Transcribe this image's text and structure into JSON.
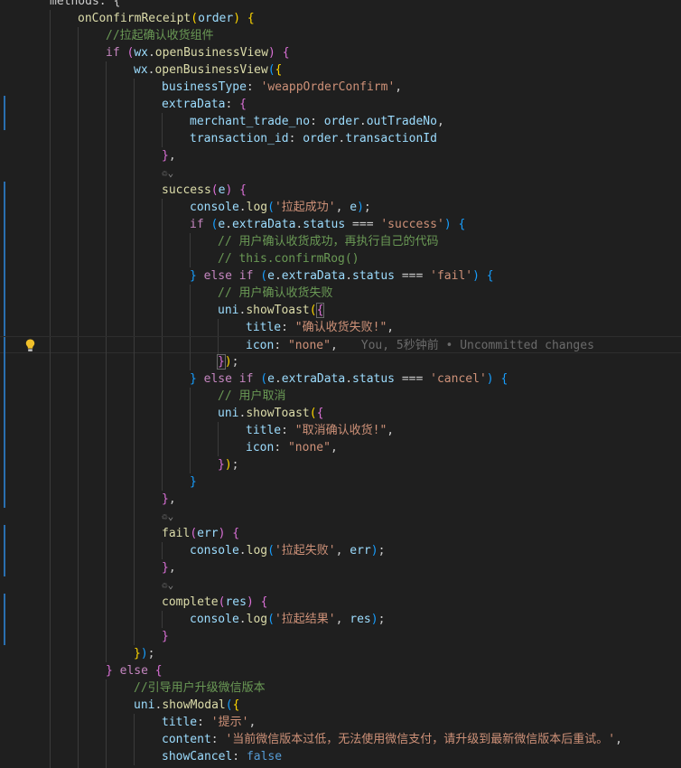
{
  "editor": {
    "lightbulb_icon": "lightbulb-icon",
    "fold_icon_name": "codelens-fold-icon",
    "colors": {
      "background": "#1f1f1f",
      "keyword": "#c586c0",
      "function": "#dcdcaa",
      "property": "#9cdcfe",
      "string": "#ce9178",
      "comment": "#6a9955",
      "bracket_1": "#ffd700",
      "bracket_2": "#da70d6",
      "bracket_3": "#179fff",
      "boolean": "#569cd6",
      "gutter_modified": "#2a6fb0"
    },
    "lines": [
      {
        "t": [
          [
            "w",
            "methods: {"
          ]
        ]
      },
      {
        "t": [
          [
            "f",
            "onConfirmReceipt"
          ],
          [
            "b1",
            "("
          ],
          [
            "p",
            "order"
          ],
          [
            "b1",
            ")"
          ],
          [
            "w",
            " "
          ],
          [
            "b1",
            "{"
          ]
        ]
      },
      {
        "t": [
          [
            "c",
            "//拉起确认收货组件"
          ]
        ]
      },
      {
        "t": [
          [
            "k",
            "if"
          ],
          [
            "w",
            " "
          ],
          [
            "b2",
            "("
          ],
          [
            "p",
            "wx"
          ],
          [
            "w",
            "."
          ],
          [
            "f",
            "openBusinessView"
          ],
          [
            "b2",
            ")"
          ],
          [
            "w",
            " "
          ],
          [
            "b2",
            "{"
          ]
        ]
      },
      {
        "t": [
          [
            "p",
            "wx"
          ],
          [
            "w",
            "."
          ],
          [
            "f",
            "openBusinessView"
          ],
          [
            "b3",
            "("
          ],
          [
            "b1",
            "{"
          ]
        ]
      },
      {
        "t": [
          [
            "p",
            "businessType"
          ],
          [
            "w",
            ": "
          ],
          [
            "s",
            "'weappOrderConfirm'"
          ],
          [
            "w",
            ","
          ]
        ]
      },
      {
        "t": [
          [
            "p",
            "extraData"
          ],
          [
            "w",
            ": "
          ],
          [
            "b2",
            "{"
          ]
        ]
      },
      {
        "t": [
          [
            "p",
            "merchant_trade_no"
          ],
          [
            "w",
            ": "
          ],
          [
            "p",
            "order"
          ],
          [
            "w",
            "."
          ],
          [
            "p",
            "outTradeNo"
          ],
          [
            "w",
            ","
          ]
        ]
      },
      {
        "t": [
          [
            "p",
            "transaction_id"
          ],
          [
            "w",
            ": "
          ],
          [
            "p",
            "order"
          ],
          [
            "w",
            "."
          ],
          [
            "p",
            "transactionId"
          ]
        ]
      },
      {
        "t": [
          [
            "b2",
            "}"
          ],
          [
            "w",
            ","
          ]
        ]
      },
      {
        "t": []
      },
      {
        "t": [
          [
            "f",
            "success"
          ],
          [
            "b2",
            "("
          ],
          [
            "p",
            "e"
          ],
          [
            "b2",
            ")"
          ],
          [
            "w",
            " "
          ],
          [
            "b2",
            "{"
          ]
        ]
      },
      {
        "t": [
          [
            "p",
            "console"
          ],
          [
            "w",
            "."
          ],
          [
            "f",
            "log"
          ],
          [
            "b3",
            "("
          ],
          [
            "s",
            "'拉起成功'"
          ],
          [
            "w",
            ", "
          ],
          [
            "p",
            "e"
          ],
          [
            "b3",
            ")"
          ],
          [
            "w",
            ";"
          ]
        ]
      },
      {
        "t": [
          [
            "k",
            "if"
          ],
          [
            "w",
            " "
          ],
          [
            "b3",
            "("
          ],
          [
            "p",
            "e"
          ],
          [
            "w",
            "."
          ],
          [
            "p",
            "extraData"
          ],
          [
            "w",
            "."
          ],
          [
            "p",
            "status"
          ],
          [
            "w",
            " === "
          ],
          [
            "s",
            "'success'"
          ],
          [
            "b3",
            ")"
          ],
          [
            "w",
            " "
          ],
          [
            "b3",
            "{"
          ]
        ]
      },
      {
        "t": [
          [
            "c",
            "// 用户确认收货成功，再执行自己的代码"
          ]
        ]
      },
      {
        "t": [
          [
            "c",
            "// this.confirmRog()"
          ]
        ]
      },
      {
        "t": [
          [
            "b3",
            "}"
          ],
          [
            "w",
            " "
          ],
          [
            "k",
            "else"
          ],
          [
            "w",
            " "
          ],
          [
            "k",
            "if"
          ],
          [
            "w",
            " "
          ],
          [
            "b3",
            "("
          ],
          [
            "p",
            "e"
          ],
          [
            "w",
            "."
          ],
          [
            "p",
            "extraData"
          ],
          [
            "w",
            "."
          ],
          [
            "p",
            "status"
          ],
          [
            "w",
            " === "
          ],
          [
            "s",
            "'fail'"
          ],
          [
            "b3",
            ")"
          ],
          [
            "w",
            " "
          ],
          [
            "b3",
            "{"
          ]
        ]
      },
      {
        "t": [
          [
            "c",
            "// 用户确认收货失败"
          ]
        ]
      },
      {
        "t": [
          [
            "p",
            "uni"
          ],
          [
            "w",
            "."
          ],
          [
            "f",
            "showToast"
          ],
          [
            "b1",
            "("
          ],
          [
            "b2",
            "{"
          ]
        ]
      },
      {
        "t": [
          [
            "p",
            "title"
          ],
          [
            "w",
            ": "
          ],
          [
            "s",
            "\"确认收货失败!\""
          ],
          [
            "w",
            ","
          ]
        ]
      },
      {
        "t": [
          [
            "p",
            "icon"
          ],
          [
            "w",
            ": "
          ],
          [
            "s",
            "\"none\""
          ],
          [
            "w",
            ","
          ]
        ],
        "blame": "You, 5秒钟前 • Uncommitted changes"
      },
      {
        "t": [
          [
            "b2",
            "}"
          ],
          [
            "b1",
            ")"
          ],
          [
            "w",
            ";"
          ]
        ]
      },
      {
        "t": [
          [
            "b3",
            "}"
          ],
          [
            "w",
            " "
          ],
          [
            "k",
            "else"
          ],
          [
            "w",
            " "
          ],
          [
            "k",
            "if"
          ],
          [
            "w",
            " "
          ],
          [
            "b3",
            "("
          ],
          [
            "p",
            "e"
          ],
          [
            "w",
            "."
          ],
          [
            "p",
            "extraData"
          ],
          [
            "w",
            "."
          ],
          [
            "p",
            "status"
          ],
          [
            "w",
            " === "
          ],
          [
            "s",
            "'cancel'"
          ],
          [
            "b3",
            ")"
          ],
          [
            "w",
            " "
          ],
          [
            "b3",
            "{"
          ]
        ]
      },
      {
        "t": [
          [
            "c",
            "// 用户取消"
          ]
        ]
      },
      {
        "t": [
          [
            "p",
            "uni"
          ],
          [
            "w",
            "."
          ],
          [
            "f",
            "showToast"
          ],
          [
            "b1",
            "("
          ],
          [
            "b2",
            "{"
          ]
        ]
      },
      {
        "t": [
          [
            "p",
            "title"
          ],
          [
            "w",
            ": "
          ],
          [
            "s",
            "\"取消确认收货!\""
          ],
          [
            "w",
            ","
          ]
        ]
      },
      {
        "t": [
          [
            "p",
            "icon"
          ],
          [
            "w",
            ": "
          ],
          [
            "s",
            "\"none\""
          ],
          [
            "w",
            ","
          ]
        ]
      },
      {
        "t": [
          [
            "b2",
            "}"
          ],
          [
            "b1",
            ")"
          ],
          [
            "w",
            ";"
          ]
        ]
      },
      {
        "t": [
          [
            "b3",
            "}"
          ]
        ]
      },
      {
        "t": [
          [
            "b2",
            "}"
          ],
          [
            "w",
            ","
          ]
        ]
      },
      {
        "t": []
      },
      {
        "t": [
          [
            "f",
            "fail"
          ],
          [
            "b2",
            "("
          ],
          [
            "p",
            "err"
          ],
          [
            "b2",
            ")"
          ],
          [
            "w",
            " "
          ],
          [
            "b2",
            "{"
          ]
        ]
      },
      {
        "t": [
          [
            "p",
            "console"
          ],
          [
            "w",
            "."
          ],
          [
            "f",
            "log"
          ],
          [
            "b3",
            "("
          ],
          [
            "s",
            "'拉起失败'"
          ],
          [
            "w",
            ", "
          ],
          [
            "p",
            "err"
          ],
          [
            "b3",
            ")"
          ],
          [
            "w",
            ";"
          ]
        ]
      },
      {
        "t": [
          [
            "b2",
            "}"
          ],
          [
            "w",
            ","
          ]
        ]
      },
      {
        "t": []
      },
      {
        "t": [
          [
            "f",
            "complete"
          ],
          [
            "b2",
            "("
          ],
          [
            "p",
            "res"
          ],
          [
            "b2",
            ")"
          ],
          [
            "w",
            " "
          ],
          [
            "b2",
            "{"
          ]
        ]
      },
      {
        "t": [
          [
            "p",
            "console"
          ],
          [
            "w",
            "."
          ],
          [
            "f",
            "log"
          ],
          [
            "b3",
            "("
          ],
          [
            "s",
            "'拉起结果'"
          ],
          [
            "w",
            ", "
          ],
          [
            "p",
            "res"
          ],
          [
            "b3",
            ")"
          ],
          [
            "w",
            ";"
          ]
        ]
      },
      {
        "t": [
          [
            "b2",
            "}"
          ]
        ]
      },
      {
        "t": [
          [
            "b1",
            "}"
          ],
          [
            "b3",
            ")"
          ],
          [
            "w",
            ";"
          ]
        ]
      },
      {
        "t": [
          [
            "b2",
            "}"
          ],
          [
            "w",
            " "
          ],
          [
            "k",
            "else"
          ],
          [
            "w",
            " "
          ],
          [
            "b2",
            "{"
          ]
        ]
      },
      {
        "t": [
          [
            "c",
            "//引导用户升级微信版本"
          ]
        ]
      },
      {
        "t": [
          [
            "p",
            "uni"
          ],
          [
            "w",
            "."
          ],
          [
            "f",
            "showModal"
          ],
          [
            "b3",
            "("
          ],
          [
            "b1",
            "{"
          ]
        ]
      },
      {
        "t": [
          [
            "p",
            "title"
          ],
          [
            "w",
            ": "
          ],
          [
            "s",
            "'提示'"
          ],
          [
            "w",
            ","
          ]
        ]
      },
      {
        "t": [
          [
            "p",
            "content"
          ],
          [
            "w",
            ": "
          ],
          [
            "s",
            "'当前微信版本过低，无法使用微信支付，请升级到最新微信版本后重试。'"
          ],
          [
            "w",
            ","
          ]
        ]
      },
      {
        "t": [
          [
            "p",
            "showCancel"
          ],
          [
            "w",
            ": "
          ],
          [
            "bl",
            "false"
          ]
        ]
      },
      {
        "t": [
          [
            "b1",
            "}"
          ],
          [
            "b3",
            ")"
          ],
          [
            "w",
            ";"
          ]
        ]
      }
    ]
  }
}
